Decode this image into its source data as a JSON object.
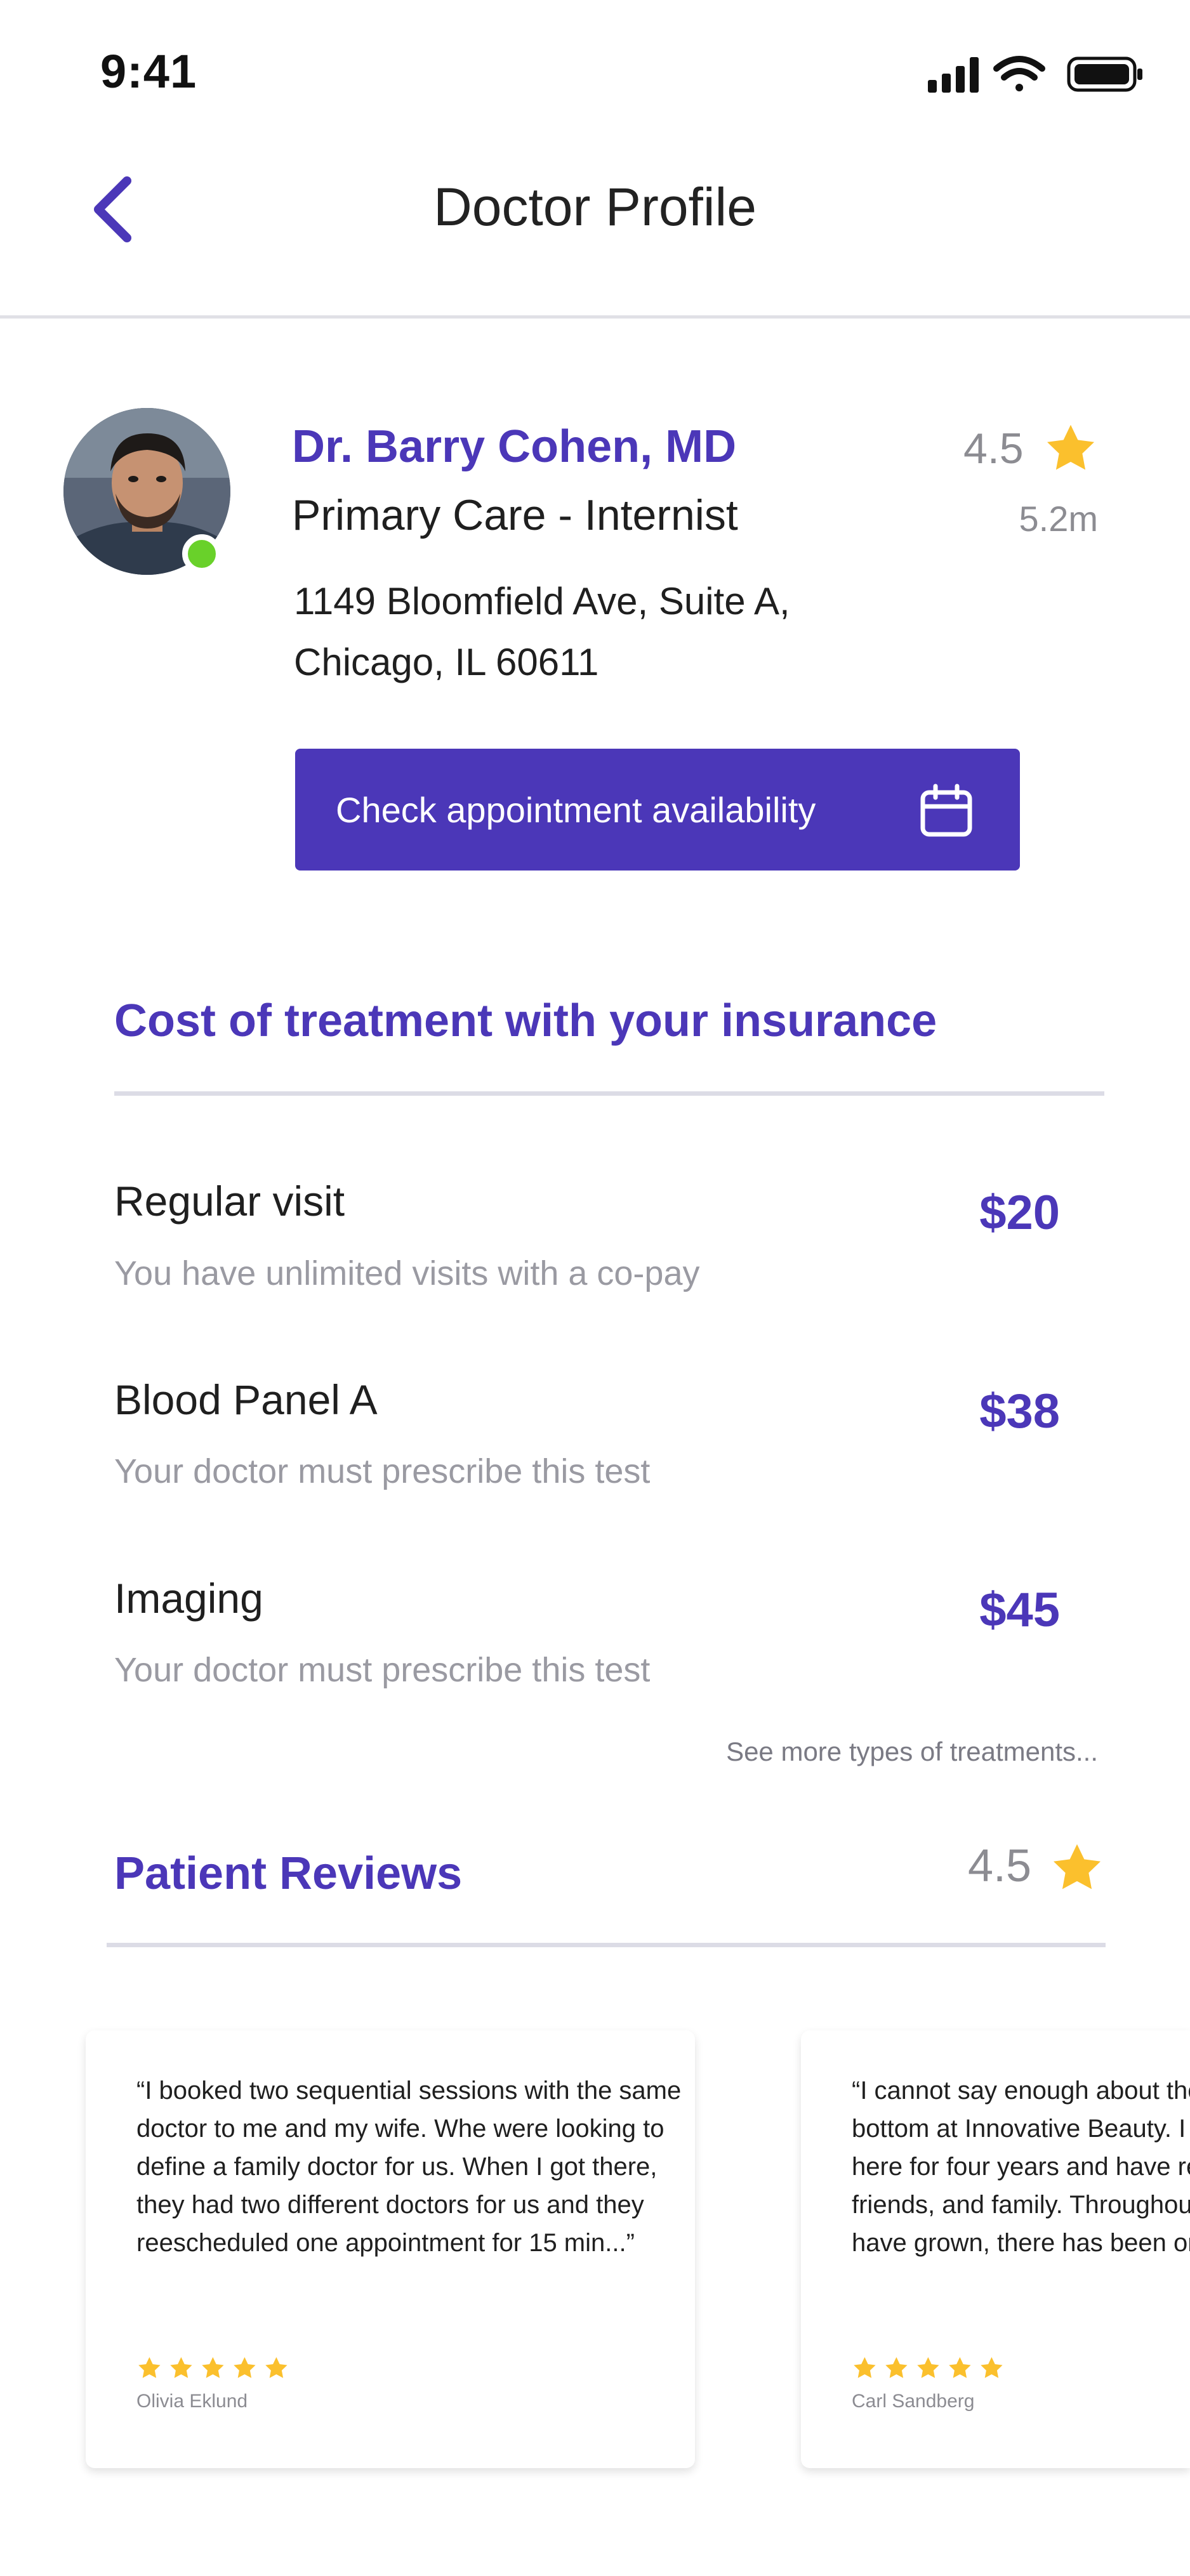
{
  "status_bar": {
    "time": "9:41"
  },
  "nav": {
    "title": "Doctor Profile"
  },
  "doctor": {
    "name": "Dr. Barry Cohen, MD",
    "specialty": "Primary Care - Internist",
    "address_line1": "1149 Bloomfield Ave, Suite A,",
    "address_line2": "Chicago, IL 60611",
    "rating": "4.5",
    "distance": "5.2m",
    "online": true
  },
  "cta": {
    "label": "Check appointment availability"
  },
  "insurance": {
    "title": "Cost of treatment with your insurance",
    "items": [
      {
        "name": "Regular visit",
        "description": "You have unlimited visits with a co-pay",
        "price": "$20"
      },
      {
        "name": "Blood Panel A",
        "description": "Your doctor must prescribe this test",
        "price": "$38"
      },
      {
        "name": "Imaging",
        "description": "Your doctor must prescribe this test",
        "price": "$45"
      }
    ],
    "see_more": "See more types of treatments..."
  },
  "reviews": {
    "title": "Patient Reviews",
    "rating": "4.5",
    "items": [
      {
        "text": "“I booked two sequential sessions with the same doctor to me and my wife. Whe were looking to define a family doctor for us. When I got there, they had two different doctors for us and they reescheduled one appointment for 15 min...”",
        "stars": 5,
        "author": "Olivia Eklund"
      },
      {
        "text": "“I cannot say enough about the staff from top to bottom at Innovative Beauty. I have been coming here for four years and have referred my clients, friends, and family. Throughout the years as they have grown, there has been one",
        "stars": 5,
        "author": "Carl Sandberg"
      }
    ]
  },
  "colors": {
    "accent": "#4b37b8",
    "star": "#fbc02d",
    "online": "#69d12a",
    "muted": "#8c8c92"
  },
  "icons": [
    "back-chevron-icon",
    "star-icon",
    "calendar-icon",
    "signal-icon",
    "wifi-icon",
    "battery-icon"
  ]
}
